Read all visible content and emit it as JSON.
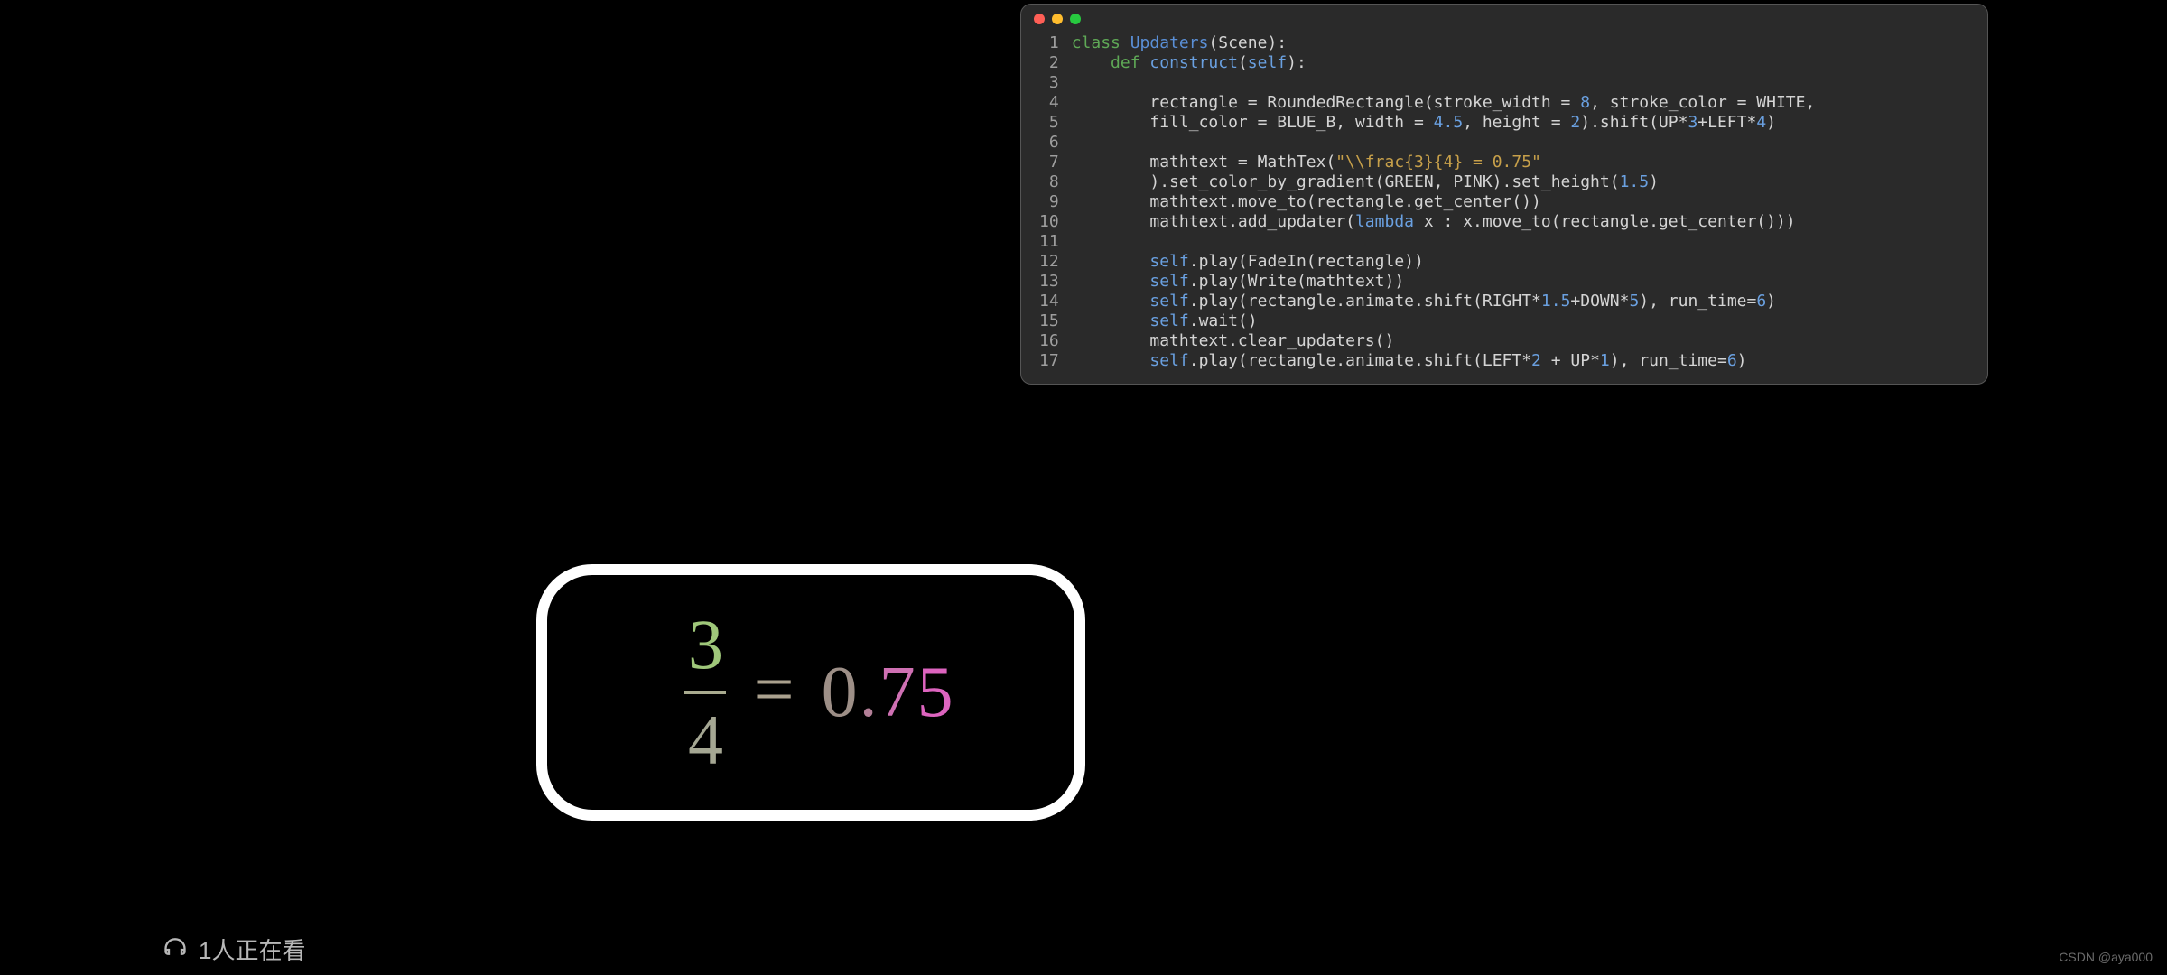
{
  "code": {
    "line_numbers": [
      "1",
      "2",
      "3",
      "4",
      "5",
      "6",
      "7",
      "8",
      "9",
      "10",
      "11",
      "12",
      "13",
      "14",
      "15",
      "16",
      "17"
    ],
    "tokens": {
      "l1": {
        "kw": "class",
        "cls": "Updaters",
        "rest": "(Scene):"
      },
      "l2": {
        "kw": "def",
        "fn": "construct",
        "p1": "(",
        "self": "self",
        "p2": "):"
      },
      "l3": "",
      "l4": {
        "pre": "        rectangle = RoundedRectangle(stroke_width = ",
        "n1": "8",
        "mid": ", stroke_color = WHITE,"
      },
      "l5": {
        "pre": "        fill_color = BLUE_B, width = ",
        "n1": "4.5",
        "mid": ", height = ",
        "n2": "2",
        "post": ").shift(UP*",
        "n3": "3",
        "plus": "+LEFT*",
        "n4": "4",
        "end": ")"
      },
      "l6": "",
      "l7": {
        "pre": "        mathtext = MathTex(",
        "str": "\"\\\\frac{3}{4} = 0.75\""
      },
      "l8": {
        "pre": "        ).set_color_by_gradient(GREEN, PINK).set_height(",
        "n1": "1.5",
        "end": ")"
      },
      "l9": "        mathtext.move_to(rectangle.get_center())",
      "l10": {
        "pre": "        mathtext.add_updater(",
        "lam": "lambda",
        "post": " x : x.move_to(rectangle.get_center()))"
      },
      "l11": "",
      "l12": {
        "pad": "        ",
        "self": "self",
        "rest": ".play(FadeIn(rectangle))"
      },
      "l13": {
        "pad": "        ",
        "self": "self",
        "rest": ".play(Write(mathtext))"
      },
      "l14": {
        "pad": "        ",
        "self": "self",
        "mid": ".play(rectangle.animate.shift(RIGHT*",
        "n1": "1.5",
        "plus": "+DOWN*",
        "n2": "5",
        "post": "), run_time=",
        "n3": "6",
        "end": ")"
      },
      "l15": {
        "pad": "        ",
        "self": "self",
        "rest": ".wait()"
      },
      "l16": "        mathtext.clear_updaters()",
      "l17": {
        "pad": "        ",
        "self": "self",
        "mid": ".play(rectangle.animate.shift(LEFT*",
        "n1": "2",
        "plus": " + UP*",
        "n2": "1",
        "post": "), run_time=",
        "n3": "6",
        "end": ")"
      }
    }
  },
  "formula": {
    "numerator": "3",
    "denominator": "4",
    "equals": "=",
    "rhs": {
      "d0": "0",
      "dot": ".",
      "d7": "7",
      "d5": "5"
    }
  },
  "viewers": {
    "text": "1人正在看"
  },
  "watermark": "CSDN @aya000"
}
